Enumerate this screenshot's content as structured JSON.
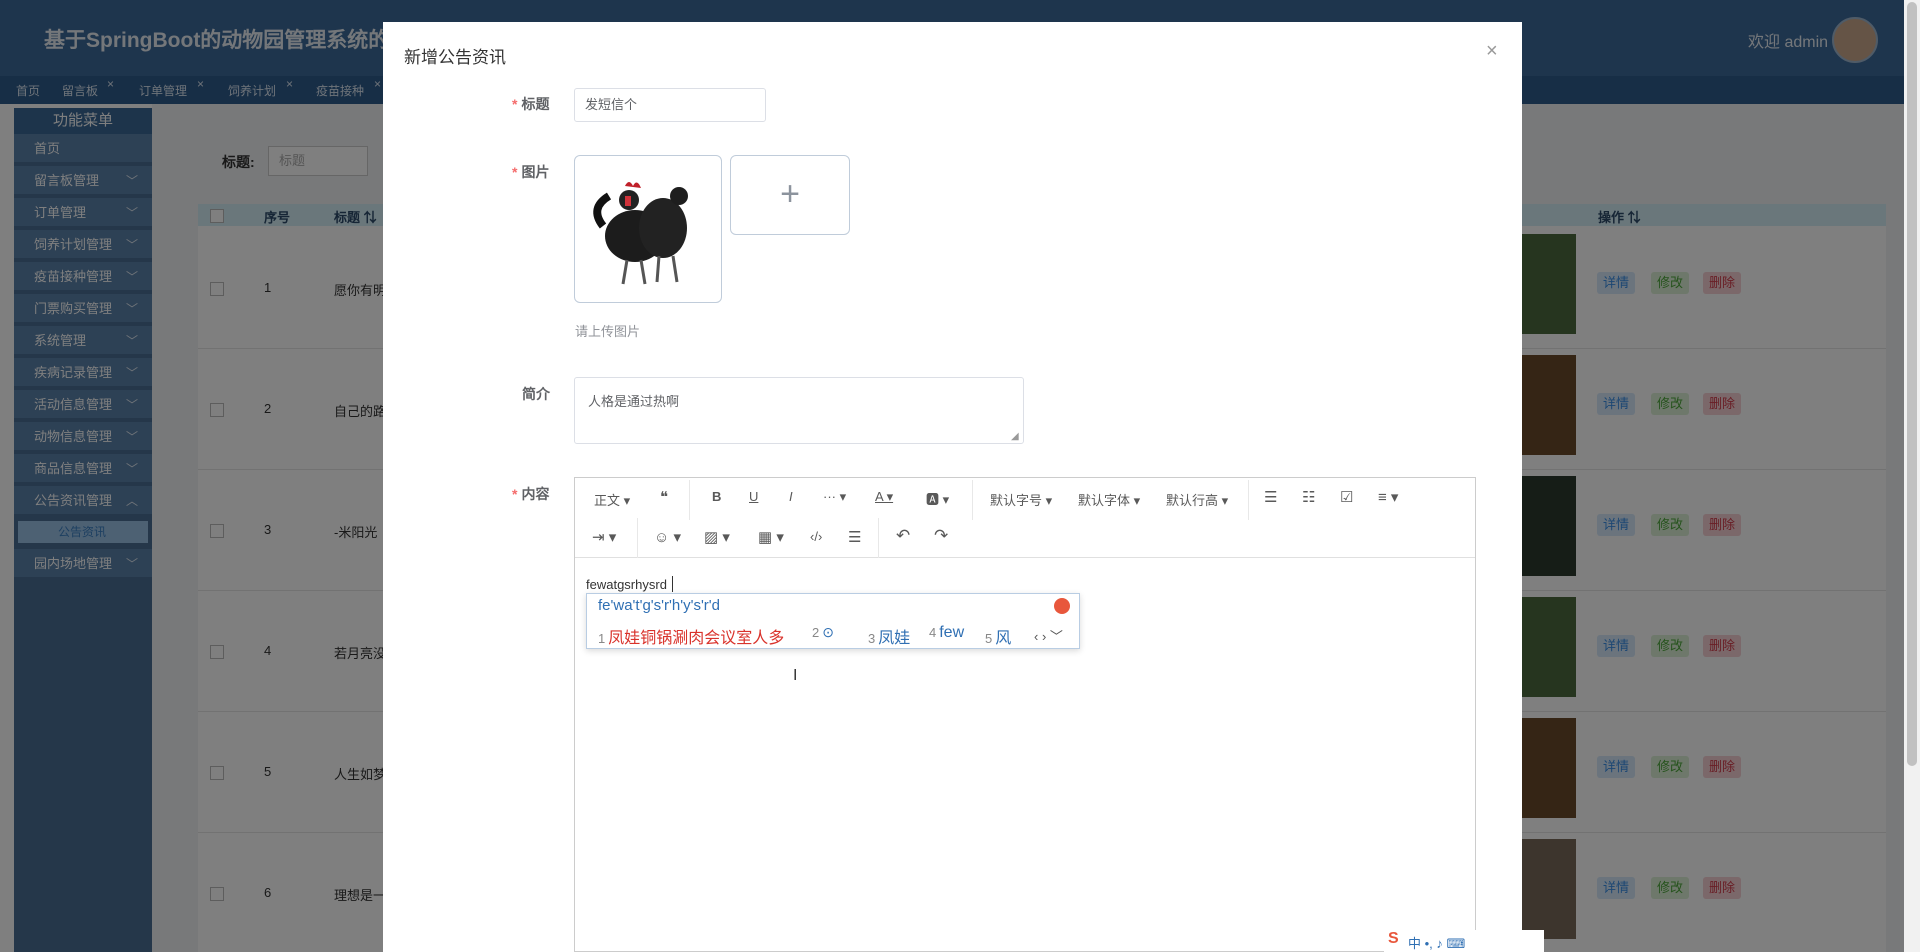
{
  "app": {
    "title": "基于SpringBoot的动物园管理系统的",
    "welcome": "欢迎 admin"
  },
  "tabs": [
    {
      "label": "首页",
      "closable": false
    },
    {
      "label": "留言板",
      "closable": true
    },
    {
      "label": "订单管理",
      "closable": true
    },
    {
      "label": "饲养计划",
      "closable": true
    },
    {
      "label": "疫苗接种",
      "closable": true
    }
  ],
  "sidebar": {
    "title": "功能菜单",
    "items": [
      {
        "label": "首页",
        "chevron": ""
      },
      {
        "label": "留言板管理",
        "chevron": "﹀"
      },
      {
        "label": "订单管理",
        "chevron": "﹀"
      },
      {
        "label": "饲养计划管理",
        "chevron": "﹀"
      },
      {
        "label": "疫苗接种管理",
        "chevron": "﹀"
      },
      {
        "label": "门票购买管理",
        "chevron": "﹀"
      },
      {
        "label": "系统管理",
        "chevron": "﹀"
      },
      {
        "label": "疾病记录管理",
        "chevron": "﹀"
      },
      {
        "label": "活动信息管理",
        "chevron": "﹀"
      },
      {
        "label": "动物信息管理",
        "chevron": "﹀"
      },
      {
        "label": "商品信息管理",
        "chevron": "﹀"
      },
      {
        "label": "公告资讯管理",
        "chevron": "︿"
      },
      {
        "label": "园内场地管理",
        "chevron": "﹀"
      }
    ],
    "sub_item": "公告资讯"
  },
  "search": {
    "label": "标题:",
    "placeholder": "标题"
  },
  "table": {
    "headers": {
      "index": "序号",
      "title": "标题 ⇅",
      "ops": "操作 ⇅"
    },
    "rows": [
      {
        "index": "1",
        "title": "愿你有明"
      },
      {
        "index": "2",
        "title": "自己的路"
      },
      {
        "index": "3",
        "title": "-米阳光"
      },
      {
        "index": "4",
        "title": "若月亮没"
      },
      {
        "index": "5",
        "title": "人生如梦"
      },
      {
        "index": "6",
        "title": "理想是一"
      }
    ],
    "ops": {
      "detail": "详情",
      "edit": "修改",
      "delete": "删除"
    }
  },
  "dialog": {
    "title": "新增公告资讯",
    "close": "×",
    "fields": {
      "title_label": "标题",
      "title_value": "发短信个",
      "image_label": "图片",
      "upload_plus": "+",
      "upload_tip": "请上传图片",
      "summary_label": "简介",
      "summary_value": "人格是通过热啊",
      "content_label": "内容",
      "required_mark": "*"
    }
  },
  "editor": {
    "toolbar": {
      "paragraph": "正文 ▾",
      "quote": "❝",
      "bold": "B",
      "underline": "U",
      "italic": "I",
      "more": "··· ▾",
      "font_color": "A ▾",
      "bg_color": "🅰 ▾",
      "font_size": "默认字号 ▾",
      "font_family": "默认字体 ▾",
      "line_height": "默认行高 ▾",
      "bullet_list": "☰",
      "numbered_list": "☷",
      "todo": "☑",
      "align": "≡ ▾",
      "indent": "⇥ ▾",
      "emoji": "☺ ▾",
      "image": "▨ ▾",
      "table": "▦ ▾",
      "code": "‹/›",
      "divider": "☰",
      "undo": "↶",
      "redo": "↷"
    },
    "content": "fewatgsrhysrd"
  },
  "ime": {
    "pinyin": "fe'wa't'g's'r'h'y's'r'd",
    "candidates": [
      {
        "num": "1",
        "text": "凤娃铜锅涮肉会议室人多",
        "color": "#d9322b"
      },
      {
        "num": "2",
        "text": "⊙",
        "color": "#2f6fb3"
      },
      {
        "num": "3",
        "text": "凤娃",
        "color": "#2f6fb3"
      },
      {
        "num": "4",
        "text": "few",
        "color": "#2f6fb3"
      },
      {
        "num": "5",
        "text": "风",
        "color": "#2f6fb3"
      }
    ],
    "nav": "‹ › ﹀",
    "bar": "中 •, ♪ ⌨"
  },
  "colors": {
    "header": "#3d6a9a",
    "accent": "#3a8ee6",
    "danger": "#f56c6c"
  }
}
